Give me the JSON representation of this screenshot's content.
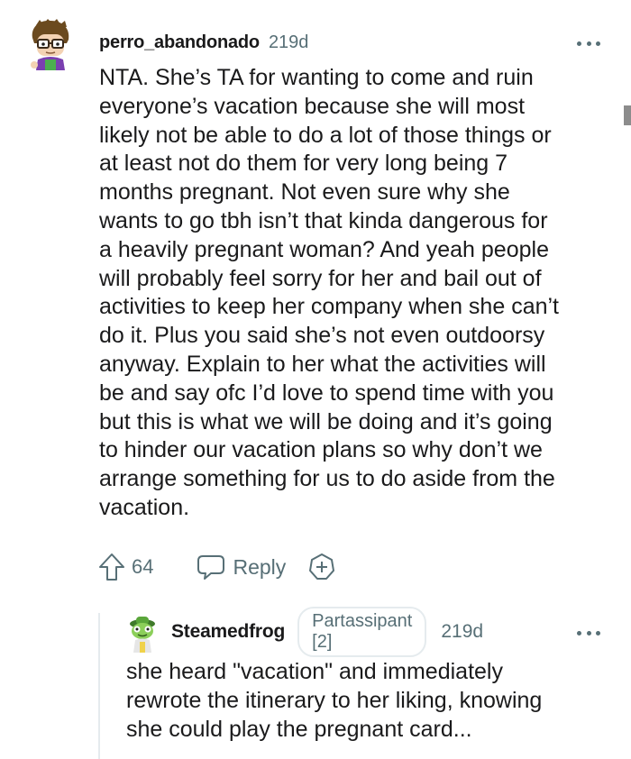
{
  "comment": {
    "username": "perro_abandonado",
    "timestamp": "219d",
    "text": "NTA. She’s TA for wanting to come and ruin\neveryone’s vacation because she will most\nlikely not be able to do a lot of those things or\nat least not do them for very long being 7\nmonths pregnant. Not even sure why she\nwants to go tbh isn’t that kinda dangerous for\na heavily pregnant woman? And yeah people\nwill probably feel sorry for her and bail out of\nactivities to keep her company when she can’t\ndo it. Plus you said she’s not even outdoorsy\nanyway. Explain to her what the activities will\nbe and say ofc I’d love to spend time with you\nbut this is what we will be doing and it’s going\nto hinder our vacation plans so why don’t we\narrange something for us to do aside from the\nvacation.",
    "upvotes": "64",
    "reply_label": "Reply"
  },
  "reply": {
    "username": "Steamedfrog",
    "flair": "Partassipant [2]",
    "timestamp": "219d",
    "text": "she heard \"vacation\" and immediately\nrewrote the itinerary to her liking, knowing\nshe could play the pregnant card..."
  },
  "icons": {
    "comment_avatar": "cartoon-avatar-with-glasses",
    "reply_avatar": "frog-avatar",
    "more": "ellipsis-icon",
    "upvote": "upvote-arrow-icon",
    "reply": "speech-bubble-icon",
    "award": "award-plus-icon"
  },
  "colors": {
    "text": "#1a1a1b",
    "muted": "#576f76",
    "thread_line": "#e5ebee"
  }
}
